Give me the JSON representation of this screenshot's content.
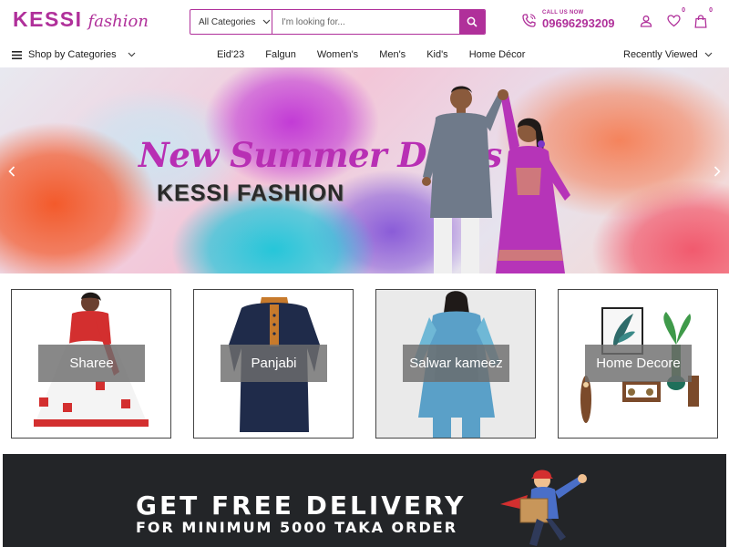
{
  "brand": {
    "logo_main": "KESSI",
    "logo_sub": "fashion",
    "accent_color": "#b0309a"
  },
  "search": {
    "category_label": "All Categories",
    "placeholder": "I'm looking for...",
    "search_icon": "search-icon"
  },
  "contact": {
    "label": "CALL US NOW",
    "phone": "09696293209",
    "icon": "phone-icon"
  },
  "header_icons": {
    "account": "user-icon",
    "wishlist": "heart-icon",
    "wishlist_count": "0",
    "cart": "bag-icon",
    "cart_count": "0"
  },
  "nav": {
    "shop_by_categories": "Shop by Categories",
    "links": [
      "Eid'23",
      "Falgun",
      "Women's",
      "Men's",
      "Kid's",
      "Home Décor"
    ],
    "recently_viewed": "Recently Viewed"
  },
  "hero": {
    "title": "New Summer Dress",
    "subtitle": "KESSI FASHION"
  },
  "categories": [
    {
      "label": "Sharee"
    },
    {
      "label": "Panjabi"
    },
    {
      "label": "Salwar kameez"
    },
    {
      "label": "Home Decore"
    }
  ],
  "banner": {
    "line1": "GET FREE DELIVERY",
    "line2": "FOR MINIMUM 5000 TAKA ORDER",
    "background": "#232528"
  }
}
